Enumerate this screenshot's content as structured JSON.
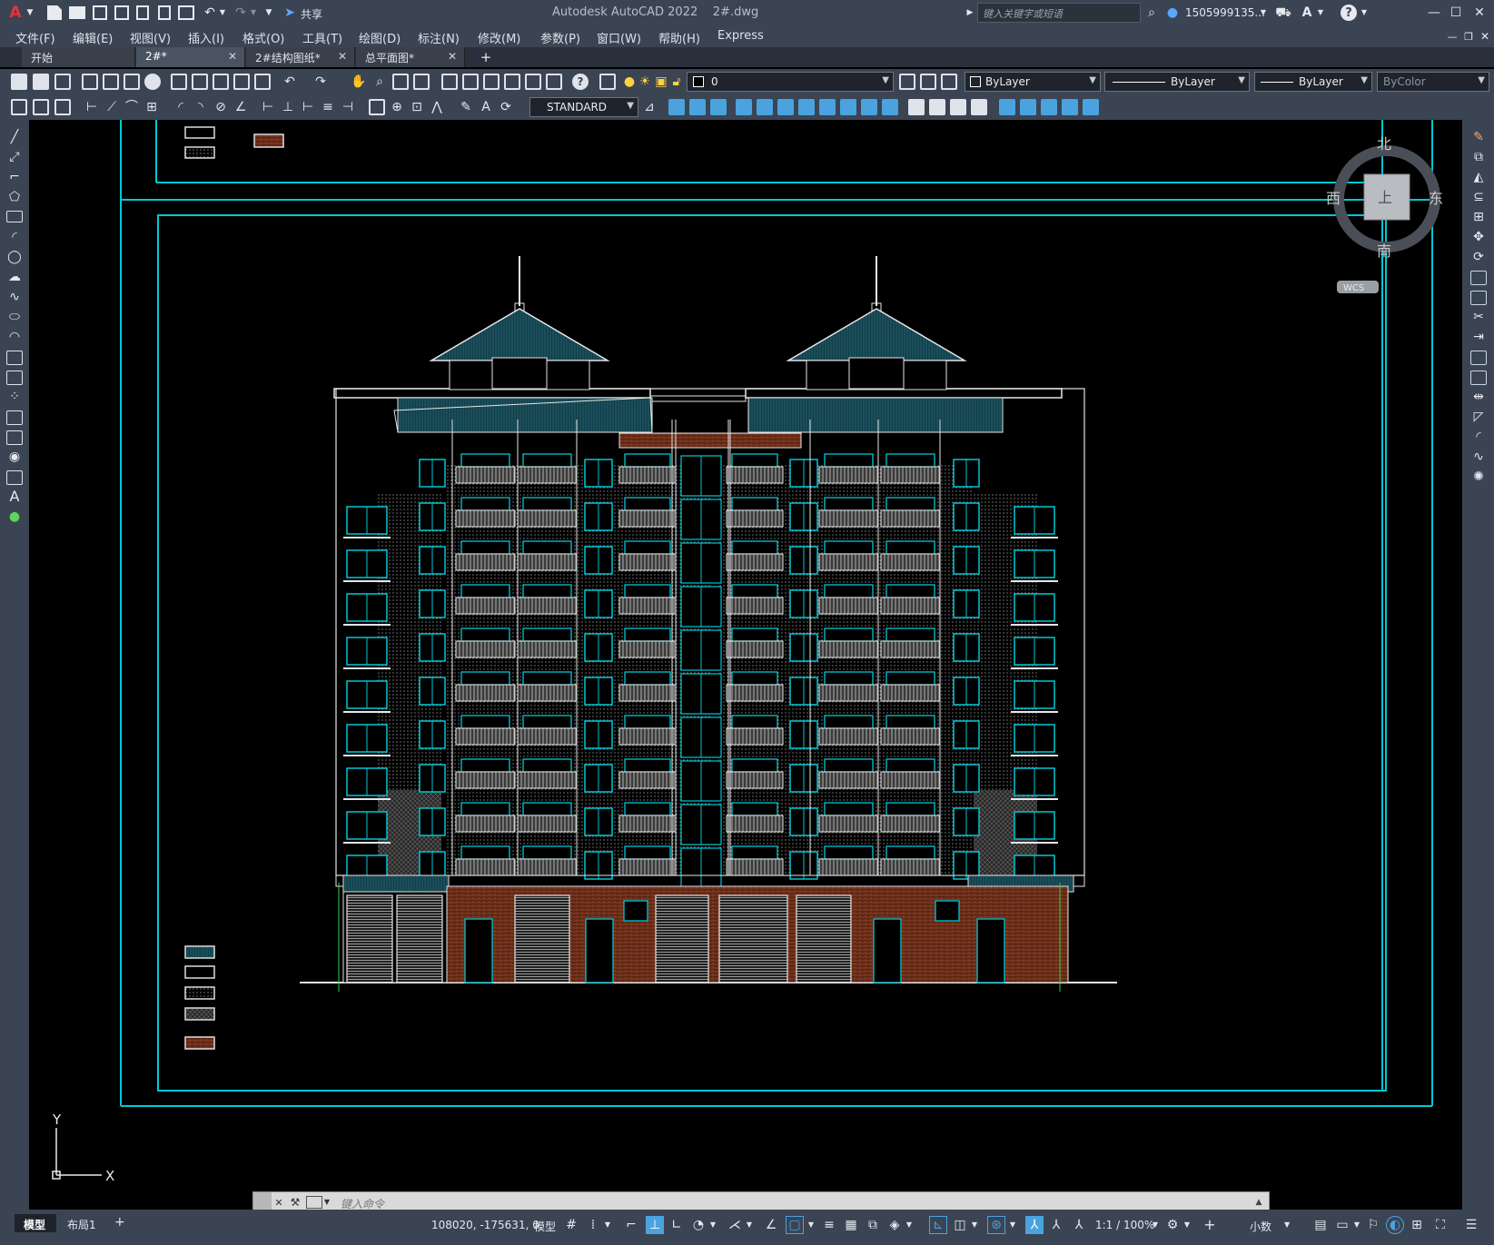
{
  "window": {
    "title": "Autodesk AutoCAD 2022    2#.dwg",
    "share_label": "共享",
    "search_placeholder": "键入关键字或短语",
    "user_name": "1505999135...",
    "controls": {
      "minimize": "—",
      "maximize": "☐",
      "close": "✕"
    }
  },
  "menu": {
    "items": [
      "文件(F)",
      "编辑(E)",
      "视图(V)",
      "插入(I)",
      "格式(O)",
      "工具(T)",
      "绘图(D)",
      "标注(N)",
      "修改(M)",
      "参数(P)",
      "窗口(W)",
      "帮助(H)",
      "Express"
    ]
  },
  "tabs": [
    {
      "label": "开始",
      "closable": false
    },
    {
      "label": "2#*",
      "closable": true,
      "active": true
    },
    {
      "label": "2#结构图纸*",
      "closable": true
    },
    {
      "label": "总平面图*",
      "closable": true
    }
  ],
  "tab_add": "+",
  "toolbar": {
    "layer_value": "0",
    "color_value": "ByLayer",
    "linetype_value": "ByLayer",
    "lineweight_value": "ByLayer",
    "plotstyle_value": "ByColor",
    "textstyle_value": "STANDARD"
  },
  "viewcube": {
    "north": "北",
    "south": "南",
    "east": "东",
    "west": "西",
    "top_face": "上",
    "wcs": "WCS"
  },
  "ucs": {
    "x": "X",
    "y": "Y"
  },
  "command": {
    "placeholder": "键入命令"
  },
  "layout_tabs": [
    "模型",
    "布局1"
  ],
  "layout_add": "+",
  "status": {
    "coordinates": "108020, -175631, 0",
    "space": "模型",
    "scale": "1:1 / 100%",
    "units": "小数"
  },
  "colors": {
    "cyan": "#00c8d4",
    "roof": "#1a4f5c",
    "brick": "#6a2a18",
    "chrome": "#3b4453",
    "white": "#e8e8e8"
  }
}
